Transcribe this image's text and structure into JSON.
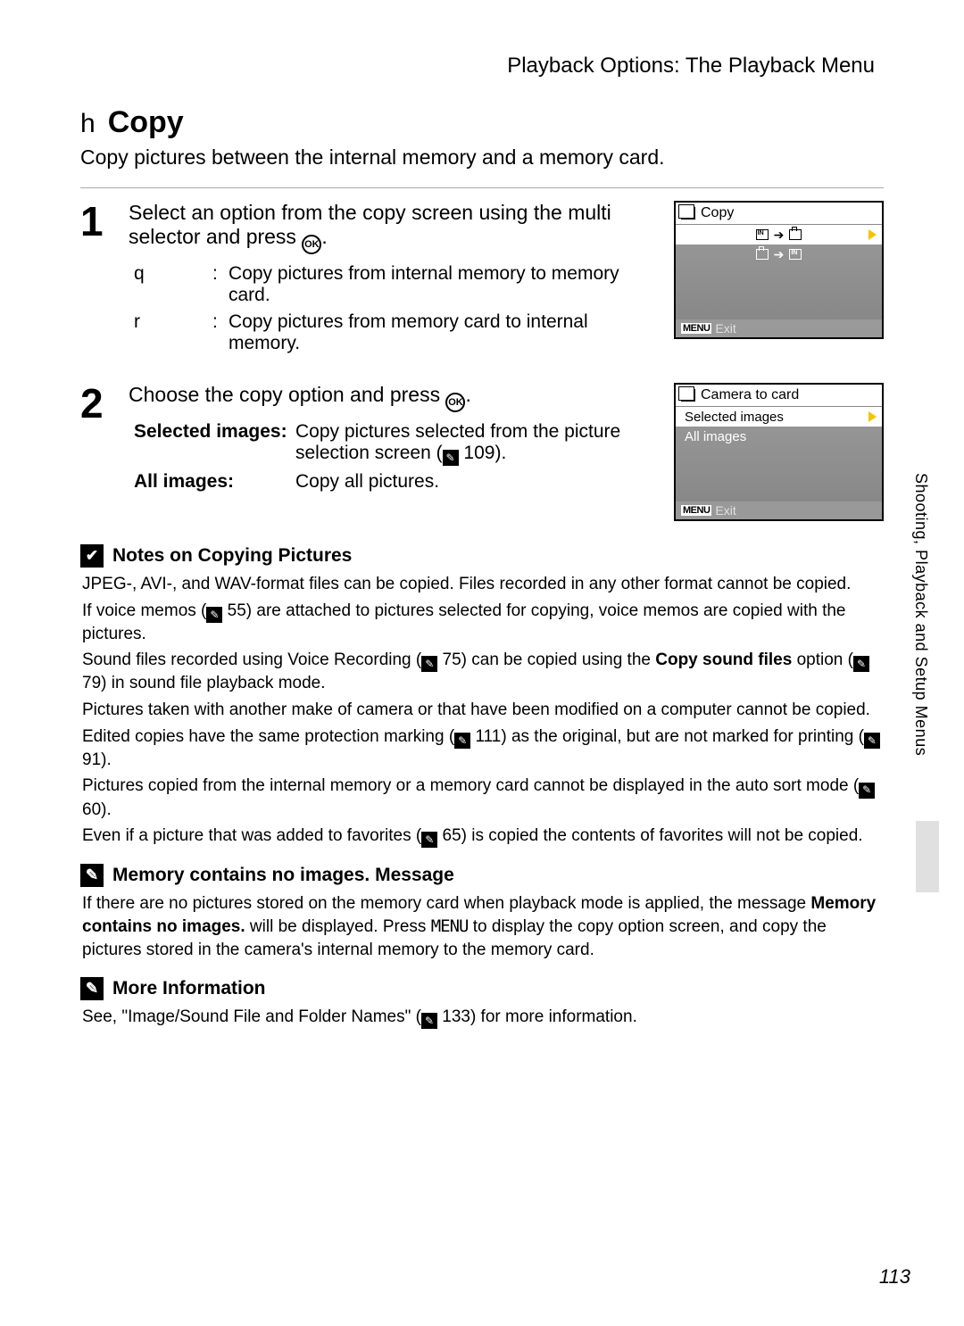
{
  "header": "Playback Options: The Playback Menu",
  "title": {
    "icon": "h",
    "text": "Copy"
  },
  "intro": "Copy pictures between the internal memory and a memory card.",
  "step1": {
    "num": "1",
    "head_a": "Select an option from the copy screen using the multi selector and press ",
    "head_b": ".",
    "opts": [
      {
        "key": "q",
        "desc": "Copy pictures from internal memory to memory card."
      },
      {
        "key": "r",
        "desc": "Copy pictures from memory card to internal memory."
      }
    ],
    "screen": {
      "title": "Copy",
      "exit": "Exit"
    }
  },
  "step2": {
    "num": "2",
    "head_a": "Choose the copy option and press ",
    "head_b": ".",
    "defs": [
      {
        "term": "Selected images:",
        "desc_a": "Copy pictures selected from the picture selection screen (",
        "ref": "109",
        "desc_b": ")."
      },
      {
        "term": "All images:",
        "desc_a": "Copy all pictures.",
        "ref": "",
        "desc_b": ""
      }
    ],
    "screen": {
      "title": "Camera to card",
      "row1": "Selected images",
      "row2": "All images",
      "exit": "Exit"
    }
  },
  "notes1": {
    "icon": "✔",
    "title": "Notes on Copying Pictures",
    "p1": "JPEG-, AVI-, and WAV-format files can be copied. Files recorded in any other format cannot be copied.",
    "p2a": "If voice memos (",
    "p2ref": "55",
    "p2b": ") are attached to pictures selected for copying, voice memos are copied with the pictures.",
    "p3a": "Sound files recorded using Voice Recording (",
    "p3ref1": "75",
    "p3b": ") can be copied using the ",
    "p3bold": "Copy sound files",
    "p3c": " option (",
    "p3ref2": "79",
    "p3d": ") in sound file playback mode.",
    "p4": "Pictures taken with another make of camera or that have been modified on a computer cannot be copied.",
    "p5a": "Edited copies have the same protection marking (",
    "p5ref1": "111",
    "p5b": ") as the original, but are not marked for printing (",
    "p5ref2": "91",
    "p5c": ").",
    "p6a": "Pictures copied from the internal memory or a memory card cannot be displayed in the auto sort mode (",
    "p6ref": "60",
    "p6b": ").",
    "p7a": "Even if a picture that was added to favorites (",
    "p7ref": "65",
    "p7b": ") is copied the contents of favorites will not be copied."
  },
  "notes2": {
    "icon": "✎",
    "title": "Memory contains no images. Message",
    "p1a": "If there are no pictures stored on the memory card when playback mode is applied, the message ",
    "p1bold": "Memory contains no images.",
    "p1b": " will be displayed. Press ",
    "p1menu": "MENU",
    "p1c": " to display the copy option screen, and copy the pictures stored in the camera's internal memory to the memory card."
  },
  "notes3": {
    "icon": "✎",
    "title": "More Information",
    "p1a": "See, \"Image/Sound File and Folder Names\" (",
    "p1ref": "133",
    "p1b": ") for more information."
  },
  "side": "Shooting, Playback and Setup Menus",
  "pagenum": "113",
  "menu_label": "MENU",
  "ok_label": "OK"
}
